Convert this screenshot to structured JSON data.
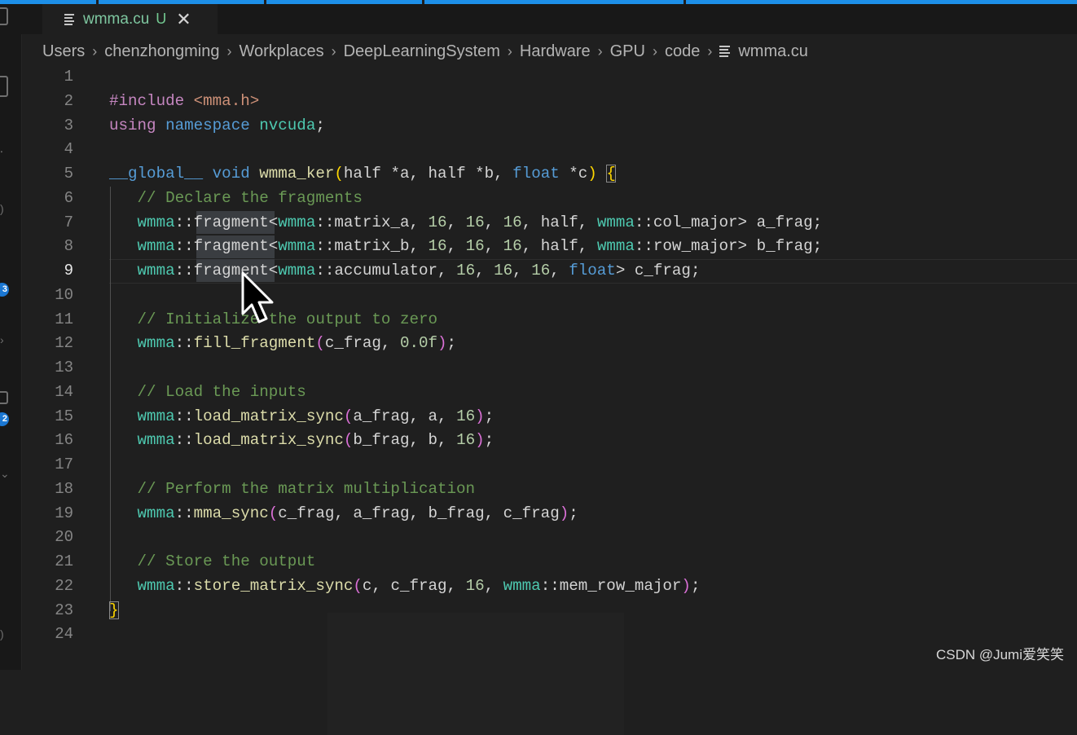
{
  "tab": {
    "filename": "wmma.cu",
    "status": "U",
    "close_glyph": "✕"
  },
  "breadcrumb": {
    "items": [
      "Users",
      "chenzhongming",
      "Workplaces",
      "DeepLearningSystem",
      "Hardware",
      "GPU",
      "code",
      "wmma.cu"
    ],
    "separator": "›"
  },
  "activity_bar": {
    "badges": [
      "3",
      "2"
    ]
  },
  "editor": {
    "active_line": 9,
    "line_numbers": [
      "1",
      "2",
      "3",
      "4",
      "5",
      "6",
      "7",
      "8",
      "9",
      "10",
      "11",
      "12",
      "13",
      "14",
      "15",
      "16",
      "17",
      "18",
      "19",
      "20",
      "21",
      "22",
      "23",
      "24"
    ],
    "code": {
      "l2_include": "#include",
      "l2_header": "<mma.h>",
      "l3_using": "using",
      "l3_namespace": "namespace",
      "l3_name": "nvcuda",
      "l3_semi": ";",
      "l5_global": "__global__",
      "l5_void": "void",
      "l5_fn": "wmma_ker",
      "l5_paren_open": "(",
      "l5_half1": "half",
      "l5_a": " *a, ",
      "l5_half2": "half",
      "l5_b": " *b, ",
      "l5_float": "float",
      "l5_c": " *c",
      "l5_paren_close": ")",
      "l5_brace": "{",
      "l6_comment": "// Declare the fragments",
      "l7_ns": "wmma",
      "l7_sep": "::",
      "l7_frag": "fragment",
      "l7_lt": "<",
      "l7_ns2": "wmma",
      "l7_rest1": "::matrix_a, ",
      "l7_n1": "16",
      "l7_n2": "16",
      "l7_n3": "16",
      "l7_half": "half",
      "l7_ns3": "wmma",
      "l7_major": "::col_major",
      "l7_tail": "> a_frag;",
      "l8_ns": "wmma",
      "l8_frag": "fragment",
      "l8_ns2": "wmma",
      "l8_rest1": "::matrix_b, ",
      "l8_half": "half",
      "l8_ns3": "wmma",
      "l8_major": "::row_major",
      "l8_tail": "> b_frag;",
      "l9_ns": "wmma",
      "l9_frag": "fragment",
      "l9_ns2": "wmma",
      "l9_rest1": "::accumulator, ",
      "l9_float": "float",
      "l9_tail": "> c_frag;",
      "l11_comment": "// Initialize the output to zero",
      "l12_ns": "wmma",
      "l12_fn": "fill_fragment",
      "l12_args": "c_frag, ",
      "l12_num": "0.0f",
      "l14_comment": "// Load the inputs",
      "l15_ns": "wmma",
      "l15_fn": "load_matrix_sync",
      "l15_args": "a_frag, a, ",
      "l16_ns": "wmma",
      "l16_fn": "load_matrix_sync",
      "l16_args": "b_frag, b, ",
      "num16": "16",
      "l18_comment": "// Perform the matrix multiplication",
      "l19_ns": "wmma",
      "l19_fn": "mma_sync",
      "l19_args": "c_frag, a_frag, b_frag, c_frag",
      "l21_comment": "// Store the output",
      "l22_ns": "wmma",
      "l22_fn": "store_matrix_sync",
      "l22_args": "c, c_frag, ",
      "l22_ns2": "wmma",
      "l22_major": "::mem_row_major",
      "l23_brace": "}",
      "comma": ", ",
      "sep": "::",
      "lt": "<",
      "po": "(",
      "pc": ")",
      "end": ");"
    }
  },
  "watermark": "CSDN @Jumi爱笑笑",
  "colors": {
    "accent": "#1d8fe8",
    "editor_bg": "#1f1f1f",
    "keyword": "#c586c0",
    "type": "#4ec9b0",
    "function": "#dcdcaa",
    "comment": "#6a9955",
    "number": "#b5cea8"
  }
}
